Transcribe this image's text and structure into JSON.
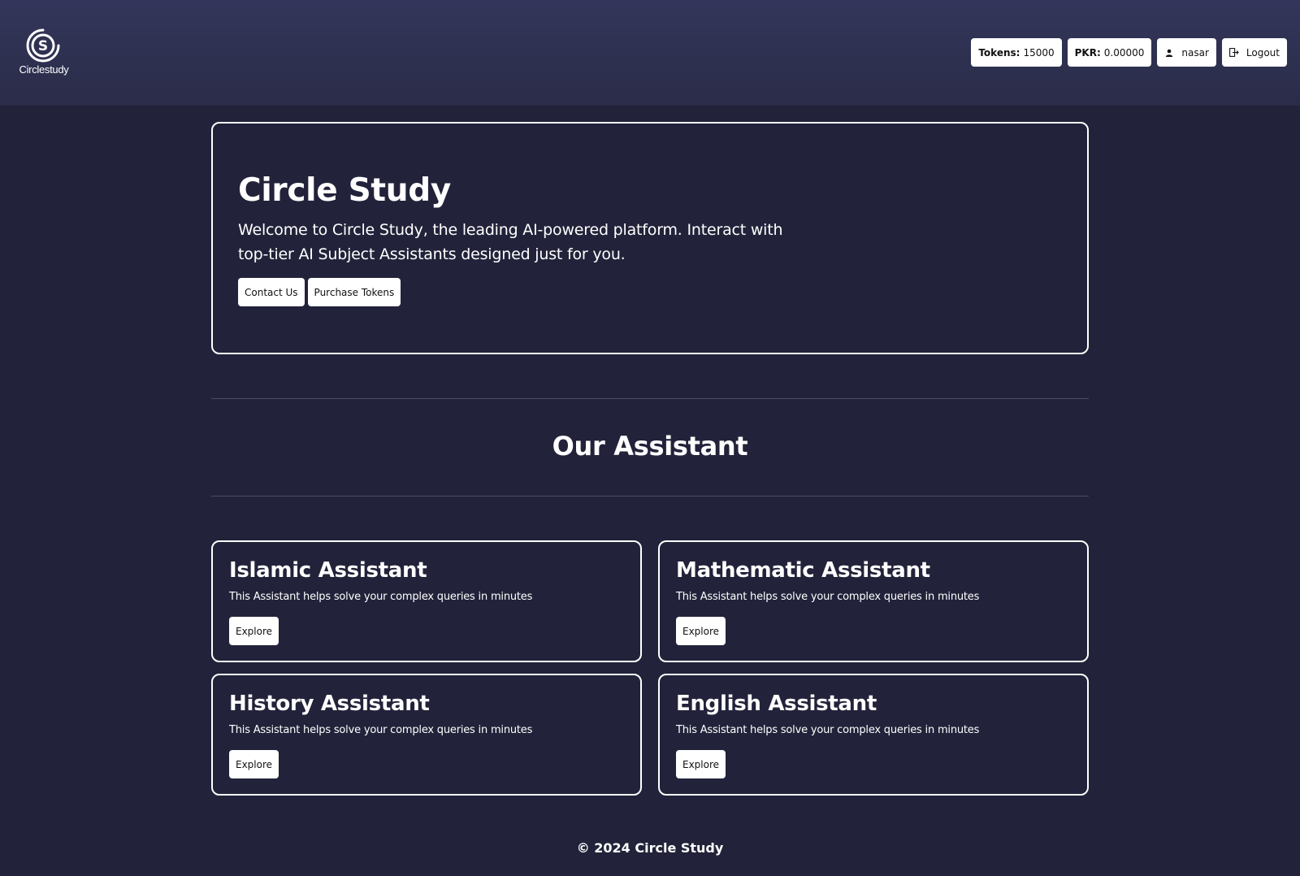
{
  "header": {
    "logo_text": "Circlestudy",
    "tokens_label": "Tokens:",
    "tokens_value": "15000",
    "pkr_label": "PKR:",
    "pkr_value": "0.00000",
    "username": "nasar",
    "logout_label": "Logout",
    "user_icon": "user-icon",
    "logout_icon": "logout-icon"
  },
  "hero": {
    "title": "Circle Study",
    "description": "Welcome to Circle Study, the leading AI-powered platform. Interact with top-tier AI Subject Assistants designed just for you.",
    "contact_label": "Contact Us",
    "purchase_label": "Purchase Tokens"
  },
  "section": {
    "title": "Our Assistant"
  },
  "assistants": [
    {
      "title": "Islamic Assistant",
      "desc": "This Assistant helps solve your complex queries in minutes",
      "button": "Explore"
    },
    {
      "title": "Mathematic Assistant",
      "desc": "This Assistant helps solve your complex queries in minutes",
      "button": "Explore"
    },
    {
      "title": "History Assistant",
      "desc": "This Assistant helps solve your complex queries in minutes",
      "button": "Explore"
    },
    {
      "title": "English Assistant",
      "desc": "This Assistant helps solve your complex queries in minutes",
      "button": "Explore"
    }
  ],
  "footer": {
    "text": "© 2024 Circle Study"
  },
  "colors": {
    "background": "#22233a",
    "header": "#2d2f4d",
    "text": "#ffffff",
    "button": "#ffffff"
  }
}
